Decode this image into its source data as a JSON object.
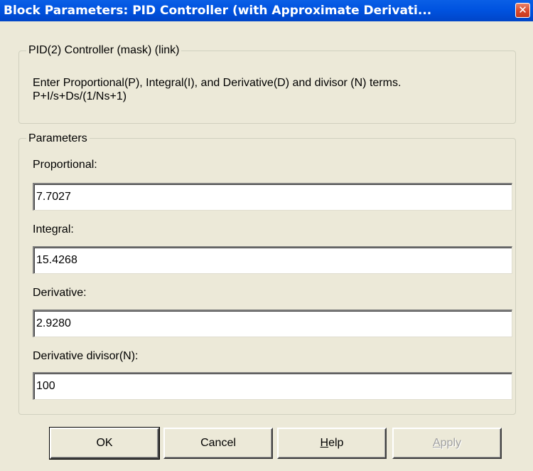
{
  "window": {
    "title": "Block Parameters: PID Controller (with Approximate Derivati...",
    "close_symbol": "✕"
  },
  "description_group": {
    "legend": "PID(2) Controller (mask) (link)",
    "line1": "Enter Proportional(P), Integral(I), and Derivative(D) and divisor (N) terms.",
    "line2": "P+I/s+Ds/(1/Ns+1)"
  },
  "parameters_group": {
    "legend": "Parameters",
    "fields": [
      {
        "label": "Proportional:",
        "value": "7.7027"
      },
      {
        "label": "Integral:",
        "value": "15.4268"
      },
      {
        "label": "Derivative:",
        "value": "2.9280"
      },
      {
        "label": "Derivative divisor(N):",
        "value": "100"
      }
    ]
  },
  "buttons": {
    "ok": "OK",
    "cancel": "Cancel",
    "help_mnemonic": "H",
    "help_rest": "elp",
    "apply_mnemonic": "A",
    "apply_rest": "pply"
  },
  "colors": {
    "titlebar": "#0053E0",
    "dialog_background": "#ECE9D8",
    "close_button": "#D9482A"
  },
  "icons": {
    "close": "close-icon"
  }
}
